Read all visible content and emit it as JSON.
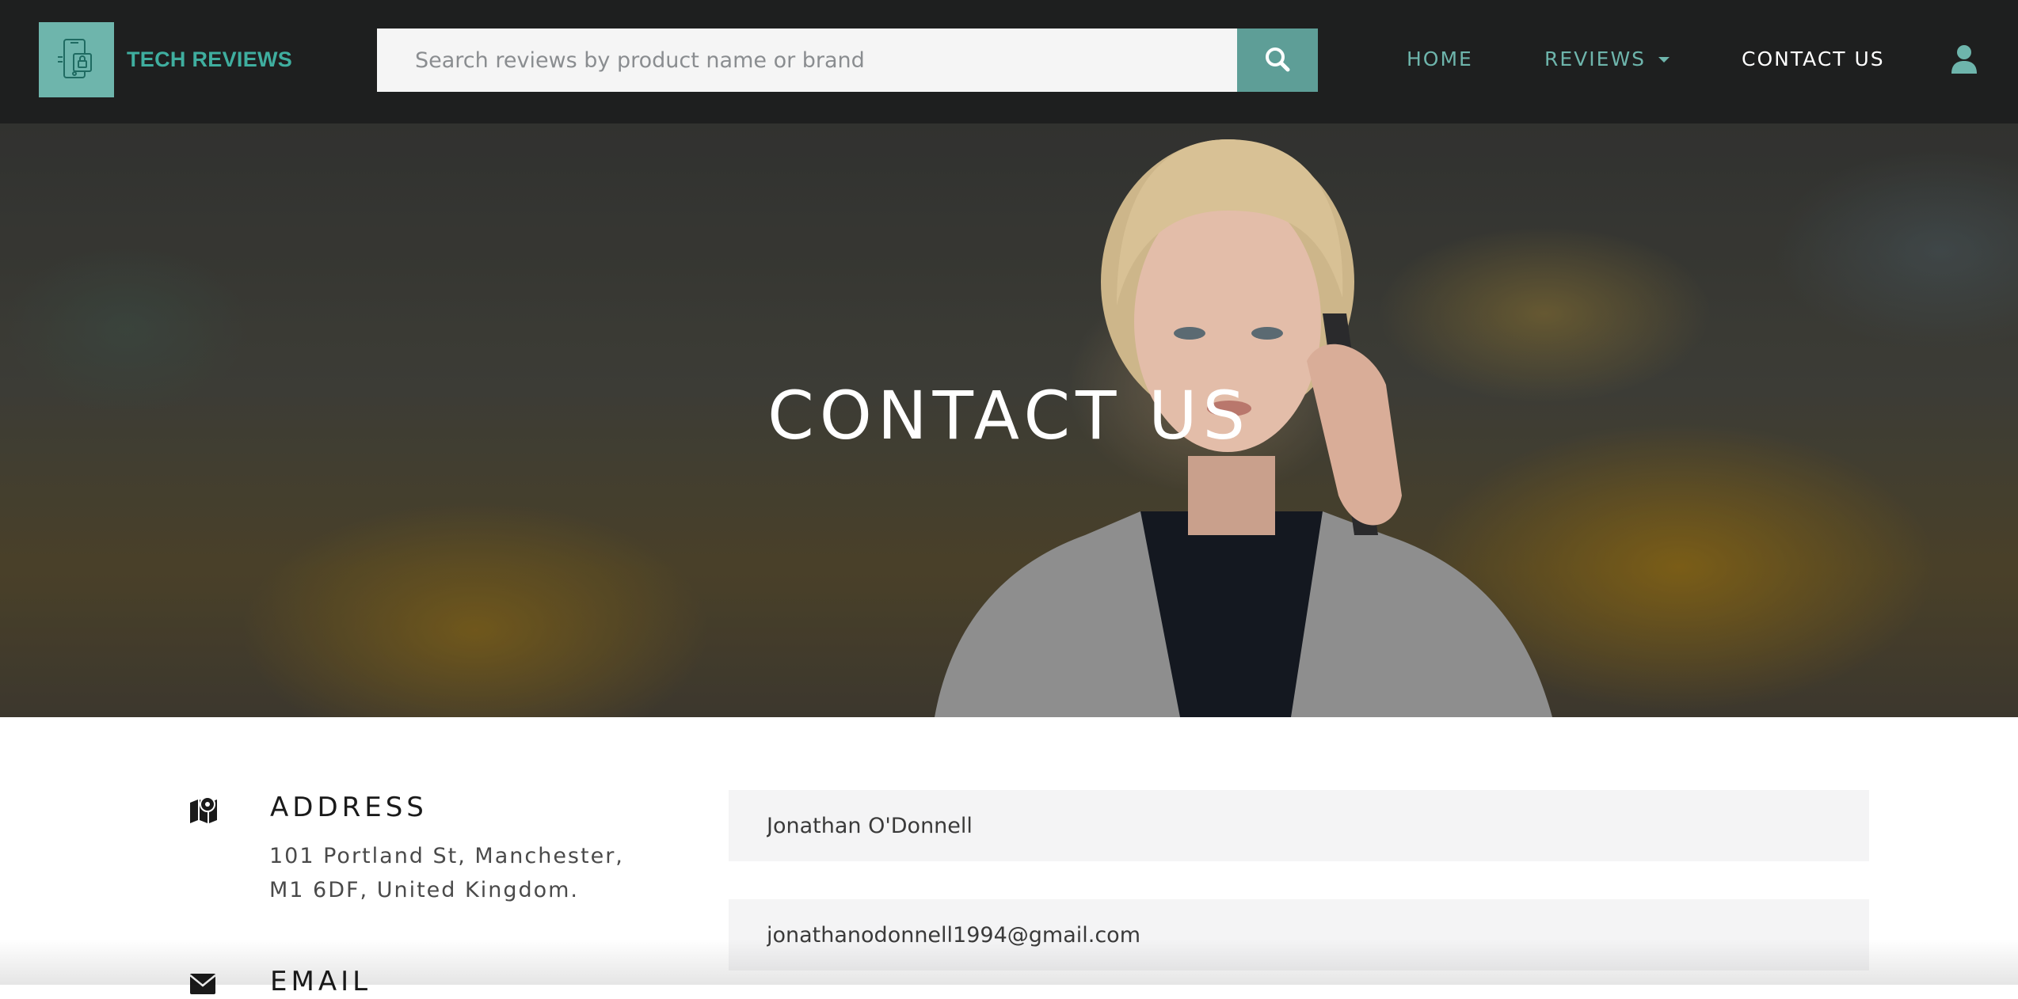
{
  "brand": {
    "name": "TECH REVIEWS",
    "logo_icon": "phone-lock-icon"
  },
  "search": {
    "placeholder": "Search reviews by product name or brand",
    "value": "",
    "button_icon": "search-icon"
  },
  "nav": {
    "home": "HOME",
    "reviews": "REVIEWS",
    "contact": "CONTACT US",
    "user_icon": "user-icon"
  },
  "hero": {
    "title": "CONTACT US"
  },
  "contact": {
    "address": {
      "heading": "ADDRESS",
      "line1": "101 Portland St, Manchester,",
      "line2": "M1 6DF, United Kingdom.",
      "icon": "map-marker-icon"
    },
    "email": {
      "heading": "EMAIL",
      "icon": "envelope-icon"
    }
  },
  "form": {
    "name_value": "Jonathan O'Donnell",
    "email_value": "jonathanodonnell1994@gmail.com"
  },
  "colors": {
    "navbar_bg": "#1e1f1f",
    "accent": "#6eb5ac",
    "accent_dark": "#5e9e97",
    "input_bg": "#f4f4f5"
  }
}
